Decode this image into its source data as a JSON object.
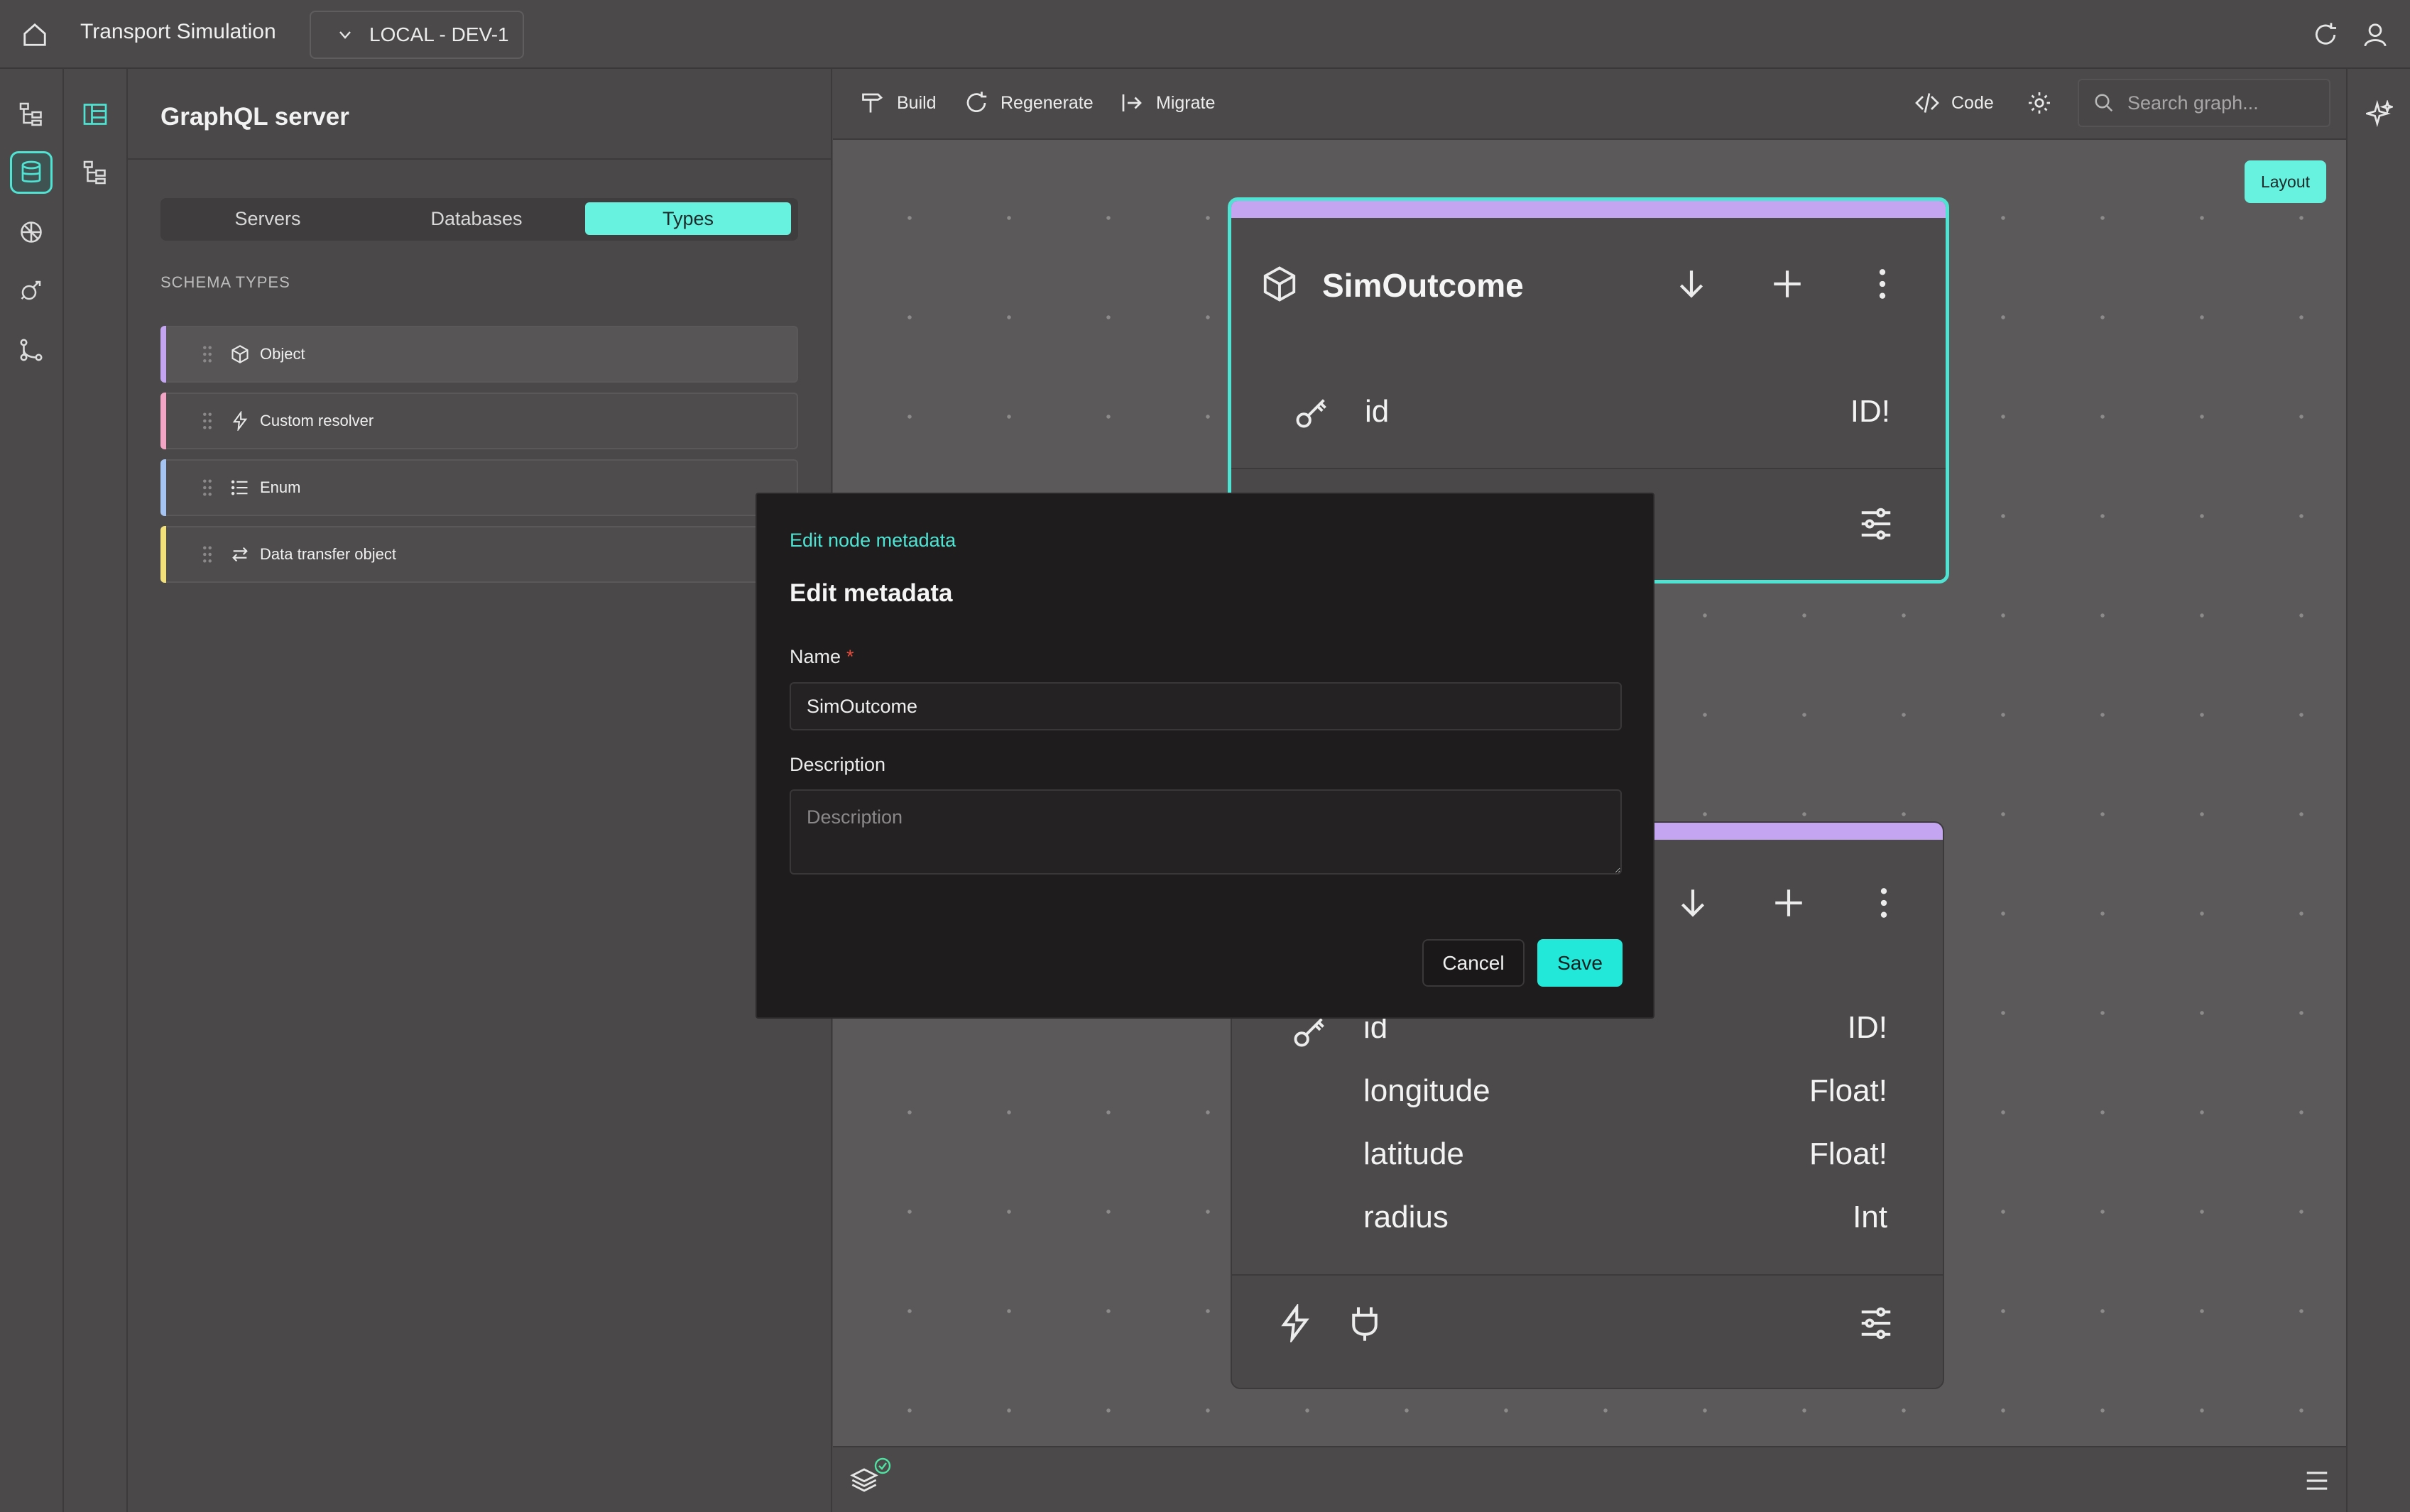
{
  "app": {
    "title": "Transport Simulation",
    "environment": "LOCAL - DEV-1"
  },
  "panel": {
    "title": "GraphQL server",
    "tabs": [
      "Servers",
      "Databases",
      "Types"
    ],
    "active_tab": "Types",
    "section_label": "SCHEMA TYPES",
    "types": [
      {
        "label": "Object",
        "icon": "cube-icon",
        "color": "#c4a5f2"
      },
      {
        "label": "Custom resolver",
        "icon": "lightning-icon",
        "color": "#f2a5c4"
      },
      {
        "label": "Enum",
        "icon": "list-icon",
        "color": "#a5c4f2"
      },
      {
        "label": "Data transfer object",
        "icon": "swap-icon",
        "color": "#f2e07a"
      }
    ]
  },
  "toolbar": {
    "build": "Build",
    "regenerate": "Regenerate",
    "migrate": "Migrate",
    "code": "Code",
    "search_placeholder": "Search graph...",
    "layout": "Layout"
  },
  "nodes": [
    {
      "title": "SimOutcome",
      "selected": true,
      "fields": [
        {
          "name": "id",
          "type": "ID!",
          "key": true
        }
      ]
    },
    {
      "title": "",
      "selected": false,
      "fields": [
        {
          "name": "id",
          "type": "ID!",
          "key": true
        },
        {
          "name": "longitude",
          "type": "Float!"
        },
        {
          "name": "latitude",
          "type": "Float!"
        },
        {
          "name": "radius",
          "type": "Int"
        }
      ]
    }
  ],
  "modal": {
    "subtitle": "Edit node metadata",
    "title": "Edit metadata",
    "name_label": "Name",
    "name_value": "SimOutcome",
    "description_label": "Description",
    "description_placeholder": "Description",
    "cancel": "Cancel",
    "save": "Save"
  },
  "colors": {
    "accent": "#4fe3d3",
    "object": "#c4a5f2",
    "save": "#21e8d8"
  }
}
